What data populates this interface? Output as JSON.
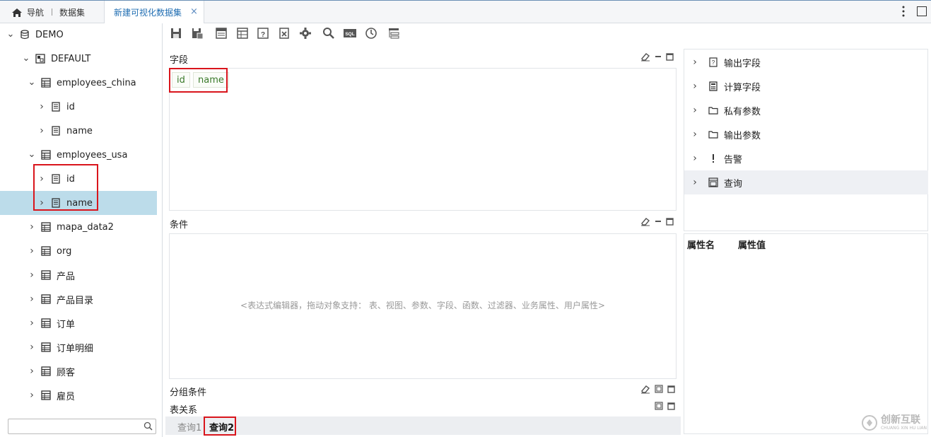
{
  "topbar": {
    "nav_label": "导航",
    "dataset_label": "数据集",
    "active_tab_label": "新建可视化数据集",
    "close_glyph": "×"
  },
  "sidebar": {
    "tree": [
      {
        "label": "DEMO",
        "level": 0,
        "expanded": true,
        "icon": "database-icon"
      },
      {
        "label": "DEFAULT",
        "level": 1,
        "expanded": true,
        "icon": "schema-icon"
      },
      {
        "label": "employees_china",
        "level": 2,
        "expanded": true,
        "icon": "table-icon"
      },
      {
        "label": "id",
        "level": 3,
        "expanded": false,
        "icon": "field-icon"
      },
      {
        "label": "name",
        "level": 3,
        "expanded": false,
        "icon": "field-icon"
      },
      {
        "label": "employees_usa",
        "level": 2,
        "expanded": true,
        "icon": "table-icon"
      },
      {
        "label": "id",
        "level": 3,
        "expanded": false,
        "icon": "field-icon"
      },
      {
        "label": "name",
        "level": 3,
        "expanded": false,
        "icon": "field-icon",
        "selected": true
      },
      {
        "label": "mapa_data2",
        "level": 2,
        "expanded": false,
        "icon": "table-icon"
      },
      {
        "label": "org",
        "level": 2,
        "expanded": false,
        "icon": "table-icon"
      },
      {
        "label": "产品",
        "level": 2,
        "expanded": false,
        "icon": "table-icon"
      },
      {
        "label": "产品目录",
        "level": 2,
        "expanded": false,
        "icon": "table-icon"
      },
      {
        "label": "订单",
        "level": 2,
        "expanded": false,
        "icon": "table-icon"
      },
      {
        "label": "订单明细",
        "level": 2,
        "expanded": false,
        "icon": "table-icon"
      },
      {
        "label": "顾客",
        "level": 2,
        "expanded": false,
        "icon": "table-icon"
      },
      {
        "label": "雇员",
        "level": 2,
        "expanded": false,
        "icon": "table-icon"
      }
    ],
    "search_placeholder": ""
  },
  "toolbar": {
    "tools": [
      "save-icon",
      "save-as-icon",
      "layout-icon",
      "table-layout-icon",
      "help-doc-icon",
      "excel-icon",
      "settings-icon",
      "search-icon",
      "sql-icon",
      "clock-icon",
      "hierarchy-icon"
    ],
    "sql_text": "SQL"
  },
  "fields_panel": {
    "title": "字段",
    "chips": [
      "id",
      "name"
    ]
  },
  "conditions_panel": {
    "title": "条件",
    "hint": "<表达式编辑器，拖动对象支持： 表、视图、参数、字段、函数、过滤器、业务属性、用户属性>"
  },
  "group_panel": {
    "title": "分组条件"
  },
  "relation_panel": {
    "title": "表关系"
  },
  "right_tree": {
    "items": [
      {
        "label": "输出字段",
        "icon": "output-field-icon"
      },
      {
        "label": "计算字段",
        "icon": "calculator-icon"
      },
      {
        "label": "私有参数",
        "icon": "folder-icon"
      },
      {
        "label": "输出参数",
        "icon": "folder-icon"
      },
      {
        "label": "告警",
        "icon": "alert-icon"
      },
      {
        "label": "查询",
        "icon": "query-icon",
        "selected": true
      }
    ]
  },
  "properties": {
    "col_name": "属性名",
    "col_value": "属性值"
  },
  "query_tabs": [
    {
      "label": "查询1",
      "active": false
    },
    {
      "label": "查询2",
      "active": true
    }
  ],
  "watermark": {
    "text": "创新互联",
    "subtext": "CHUANG XIN HU LIAN"
  },
  "colors": {
    "accent": "#1f6db2",
    "highlight_red": "#d9151c",
    "selected_row": "#bcdcea",
    "chip_text": "#3a7a2a"
  }
}
